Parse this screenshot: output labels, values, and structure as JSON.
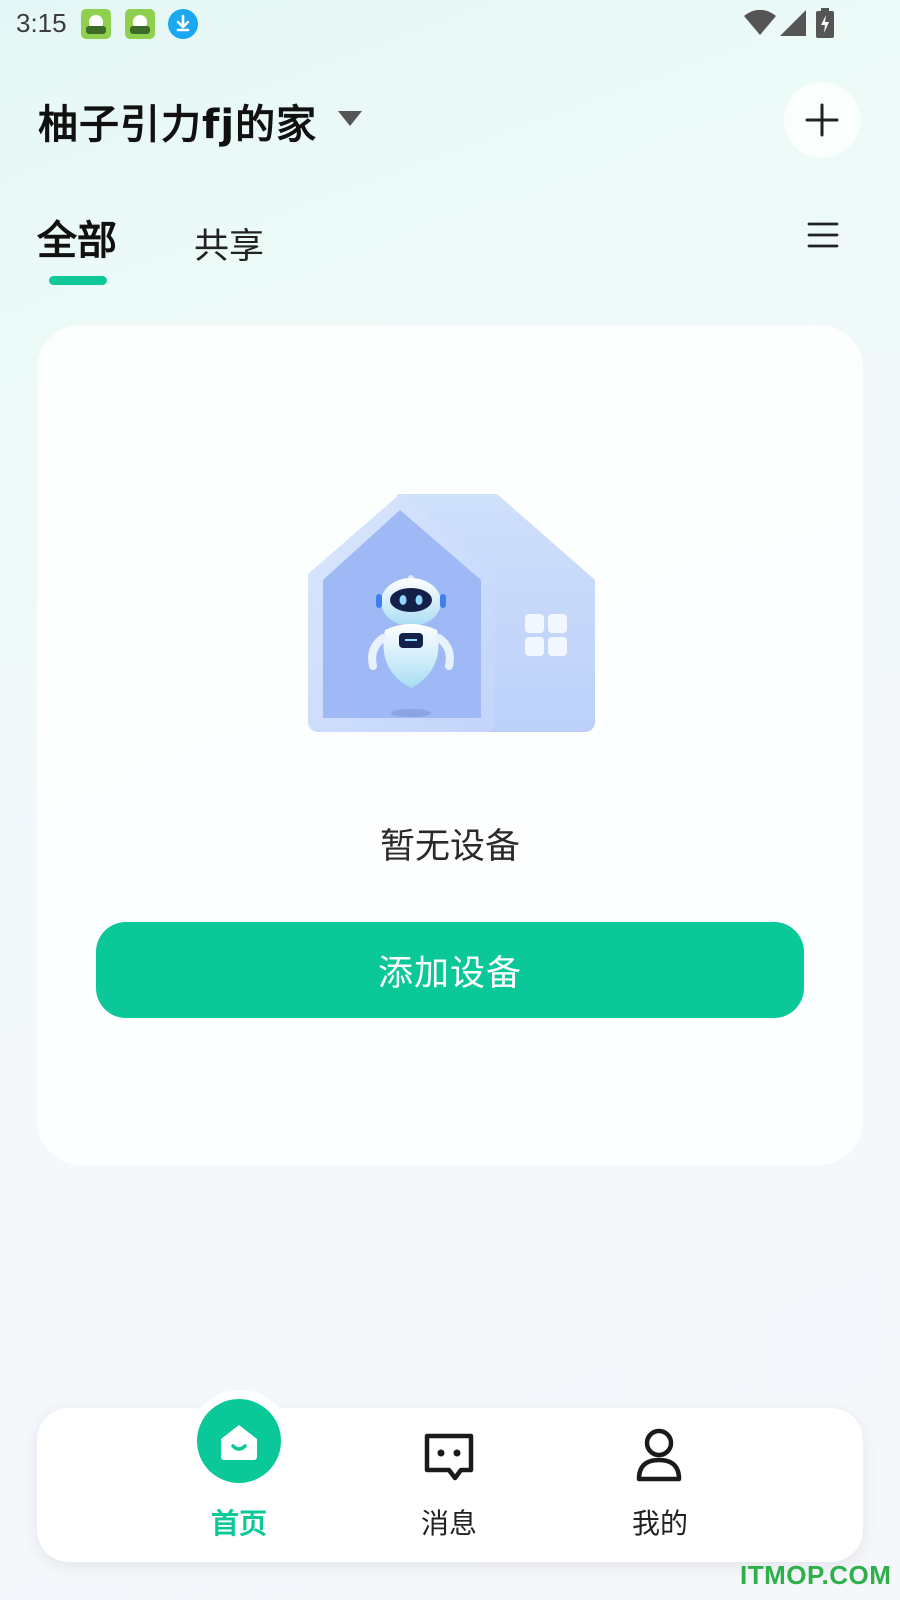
{
  "status_bar": {
    "time": "3:15",
    "notifications": [
      "app-notification-icon",
      "app-notification-icon",
      "download-icon"
    ],
    "right_icons": [
      "wifi-icon",
      "signal-icon",
      "battery-charging-icon"
    ]
  },
  "header": {
    "home_name": "柚子引力fj的家",
    "add_icon": "plus-icon"
  },
  "tabs": [
    {
      "label": "全部",
      "active": true
    },
    {
      "label": "共享",
      "active": false
    }
  ],
  "menu_icon": "menu-icon",
  "empty_state": {
    "illustration": "house-robot-illustration",
    "message": "暂无设备",
    "button_label": "添加设备"
  },
  "bottom_nav": [
    {
      "label": "首页",
      "icon": "home-icon",
      "active": true
    },
    {
      "label": "消息",
      "icon": "message-icon",
      "active": false
    },
    {
      "label": "我的",
      "icon": "person-icon",
      "active": false
    }
  ],
  "watermark": "ITMOP.COM",
  "colors": {
    "accent": "#0AC898",
    "text_primary": "#111111",
    "card_bg": "#FFFFFF"
  }
}
